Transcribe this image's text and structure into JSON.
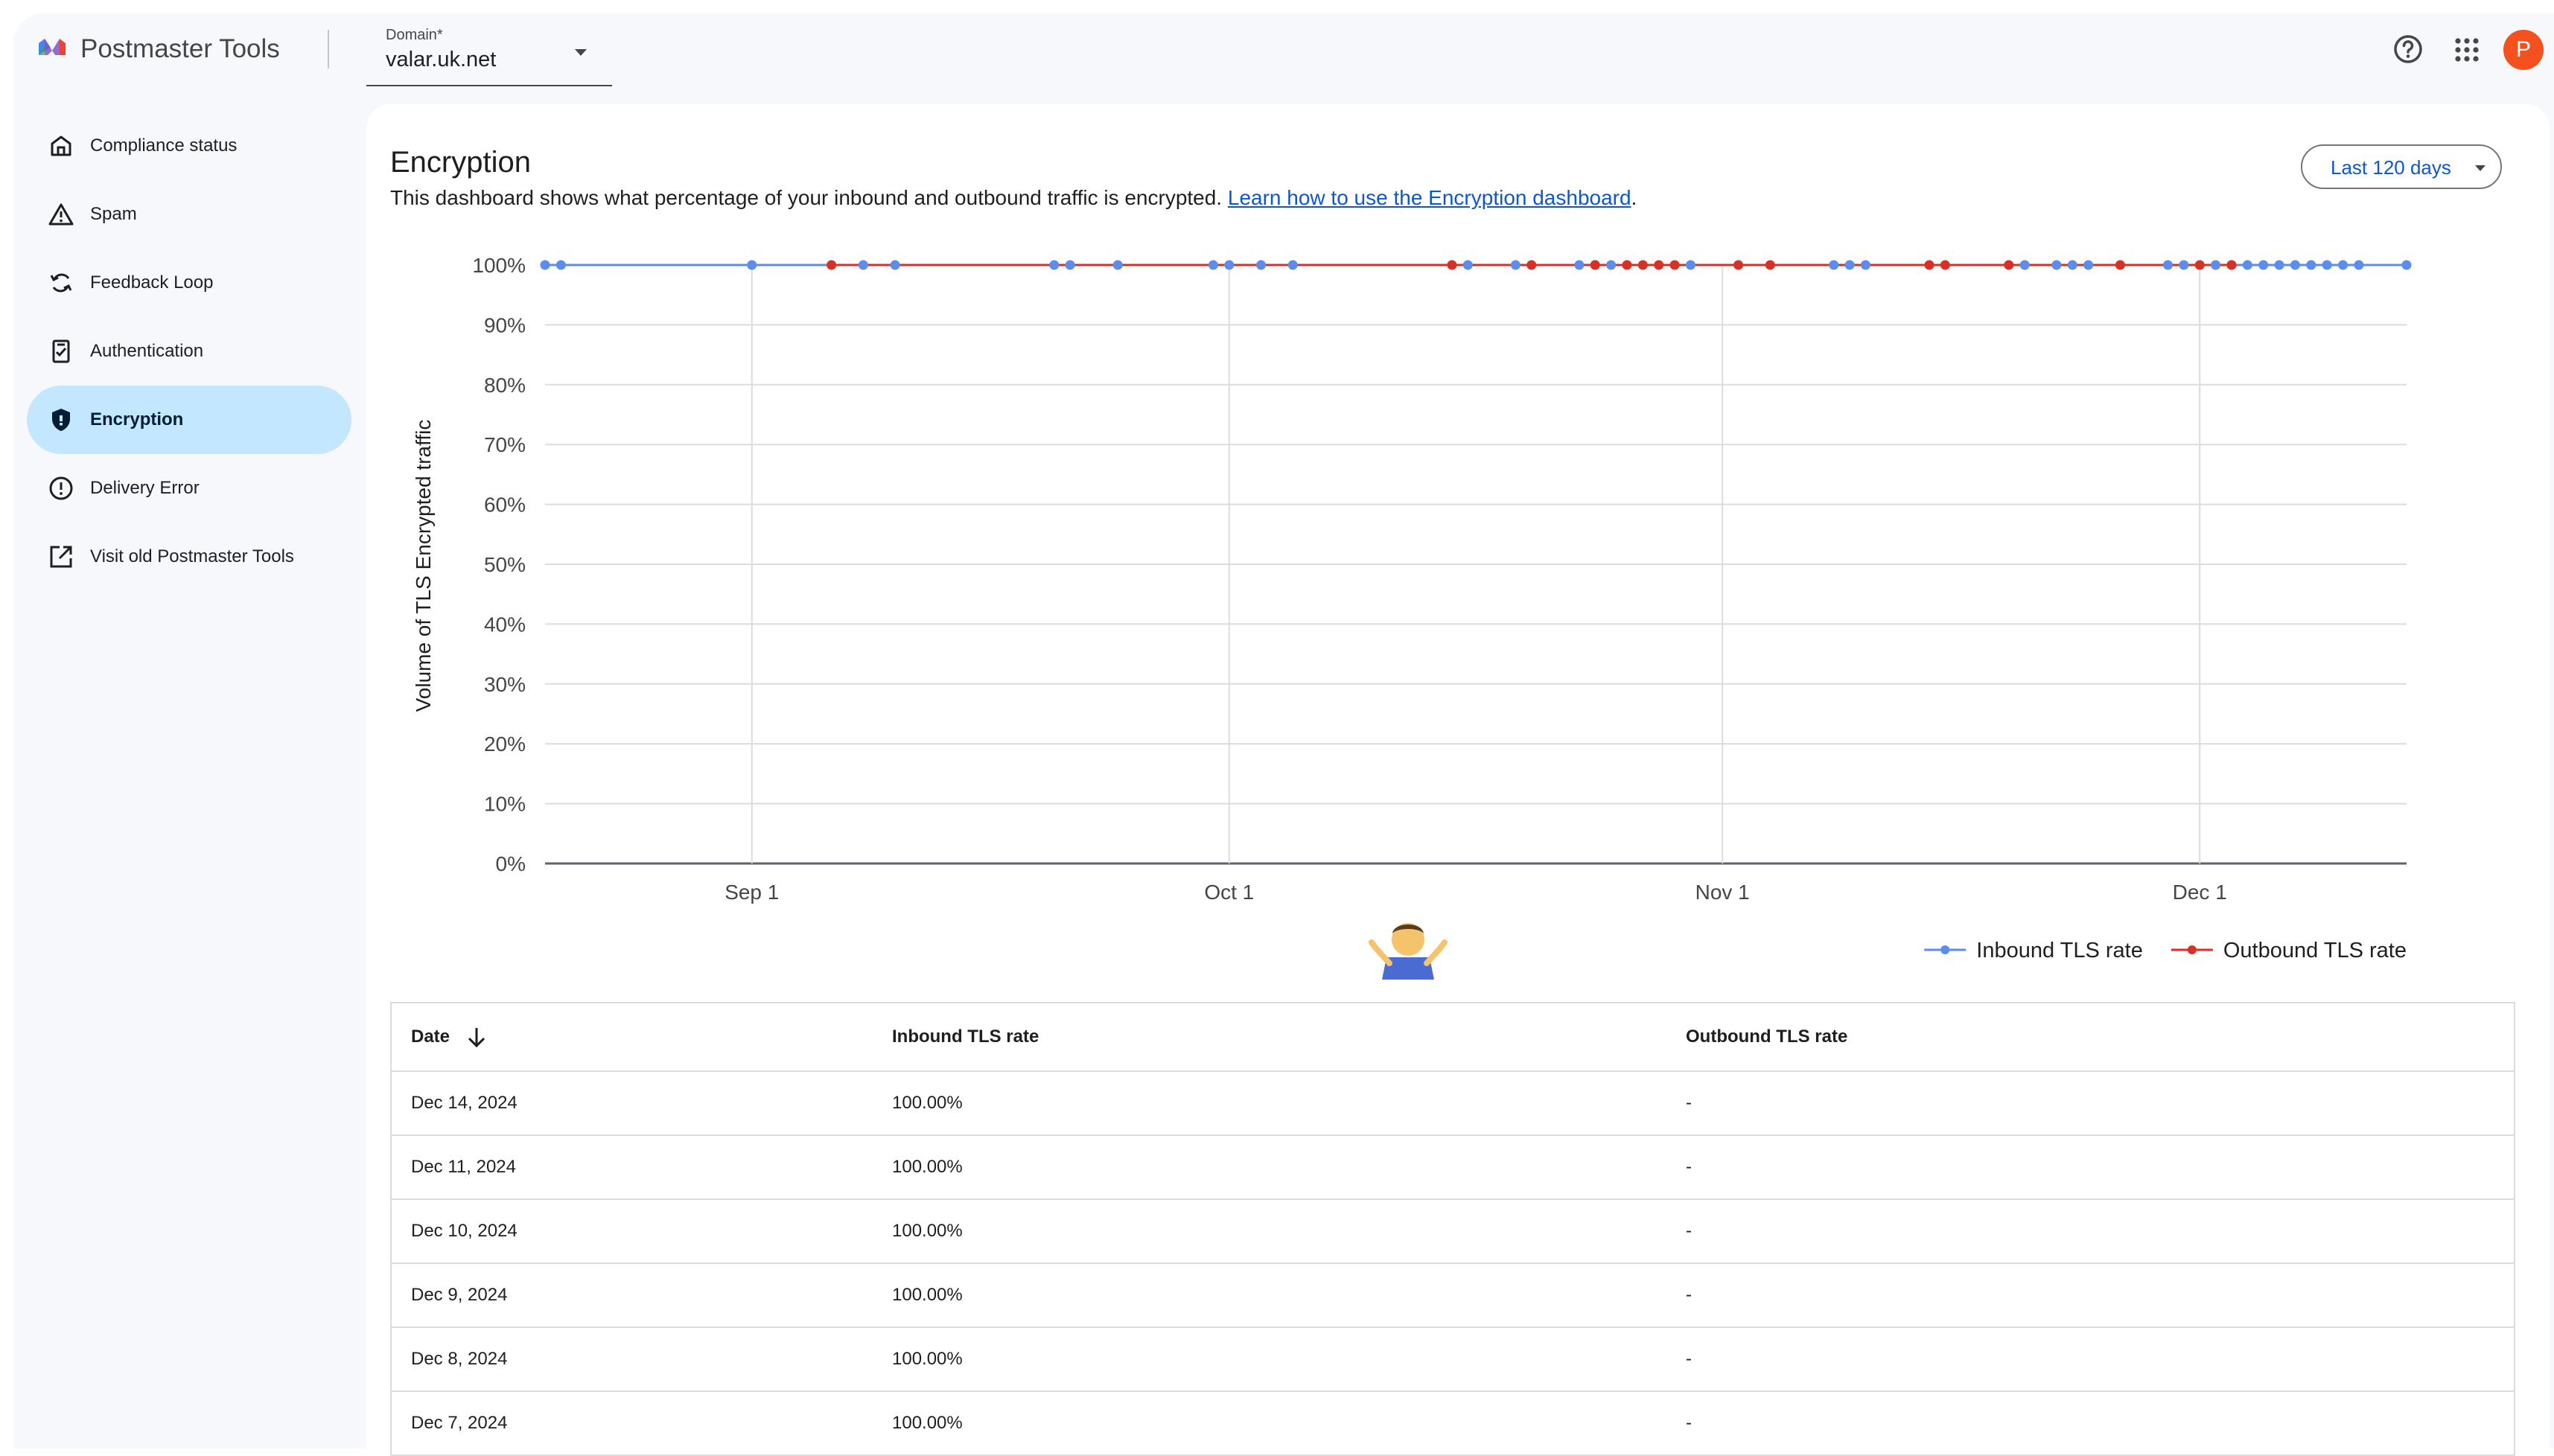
{
  "app": {
    "title": "Postmaster Tools"
  },
  "domain": {
    "label": "Domain*",
    "value": "valar.uk.net"
  },
  "header": {
    "avatar_letter": "P",
    "help_icon": "help-circle-icon",
    "apps_icon": "apps-grid-icon"
  },
  "sidebar": {
    "items": [
      {
        "label": "Compliance status",
        "icon": "home-icon",
        "active": false
      },
      {
        "label": "Spam",
        "icon": "warning-icon",
        "active": false
      },
      {
        "label": "Feedback Loop",
        "icon": "refresh-icon",
        "active": false
      },
      {
        "label": "Authentication",
        "icon": "checklist-icon",
        "active": false
      },
      {
        "label": "Encryption",
        "icon": "shield-icon",
        "active": true
      },
      {
        "label": "Delivery Error",
        "icon": "error-icon",
        "active": false
      },
      {
        "label": "Visit old Postmaster Tools",
        "icon": "open-in-new-icon",
        "active": false
      }
    ]
  },
  "page": {
    "title": "Encryption",
    "description": "This dashboard shows what percentage of your inbound and outbound traffic is encrypted.",
    "link": "Learn how to use the Encryption dashboard",
    "period": ".",
    "range": "Last 120 days"
  },
  "chart_data": {
    "type": "line",
    "ylabel": "Volume of TLS Encrypted traffic",
    "xlabel": "",
    "ylim": [
      0,
      100
    ],
    "y_ticks": [
      "0%",
      "10%",
      "20%",
      "30%",
      "40%",
      "50%",
      "60%",
      "70%",
      "80%",
      "90%",
      "100%"
    ],
    "x_range": [
      "2024-08-19",
      "2024-12-14"
    ],
    "x_ticks": [
      {
        "date": "2024-09-01",
        "label": "Sep 1"
      },
      {
        "date": "2024-10-01",
        "label": "Oct 1"
      },
      {
        "date": "2024-11-01",
        "label": "Nov 1"
      },
      {
        "date": "2024-12-01",
        "label": "Dec 1"
      }
    ],
    "grid": true,
    "legend_position": "bottom-right",
    "series": [
      {
        "name": "Inbound TLS rate",
        "color": "#5b8def",
        "points": [
          [
            "2024-08-19",
            100
          ],
          [
            "2024-08-20",
            100
          ],
          [
            "2024-09-01",
            100
          ],
          [
            "2024-09-08",
            100
          ],
          [
            "2024-09-10",
            100
          ],
          [
            "2024-09-20",
            100
          ],
          [
            "2024-09-21",
            100
          ],
          [
            "2024-09-24",
            100
          ],
          [
            "2024-09-30",
            100
          ],
          [
            "2024-10-01",
            100
          ],
          [
            "2024-10-03",
            100
          ],
          [
            "2024-10-05",
            100
          ],
          [
            "2024-10-16",
            100
          ],
          [
            "2024-10-19",
            100
          ],
          [
            "2024-10-23",
            100
          ],
          [
            "2024-10-24",
            100
          ],
          [
            "2024-10-25",
            100
          ],
          [
            "2024-10-30",
            100
          ],
          [
            "2024-11-08",
            100
          ],
          [
            "2024-11-09",
            100
          ],
          [
            "2024-11-10",
            100
          ],
          [
            "2024-11-20",
            100
          ],
          [
            "2024-11-22",
            100
          ],
          [
            "2024-11-23",
            100
          ],
          [
            "2024-11-24",
            100
          ],
          [
            "2024-11-29",
            100
          ],
          [
            "2024-11-30",
            100
          ],
          [
            "2024-12-02",
            100
          ],
          [
            "2024-12-03",
            100
          ],
          [
            "2024-12-04",
            100
          ],
          [
            "2024-12-05",
            100
          ],
          [
            "2024-12-06",
            100
          ],
          [
            "2024-12-07",
            100
          ],
          [
            "2024-12-08",
            100
          ],
          [
            "2024-12-09",
            100
          ],
          [
            "2024-12-10",
            100
          ],
          [
            "2024-12-11",
            100
          ],
          [
            "2024-12-14",
            100
          ]
        ]
      },
      {
        "name": "Outbound TLS rate",
        "color": "#d93025",
        "points": [
          [
            "2024-09-06",
            100
          ],
          [
            "2024-10-15",
            100
          ],
          [
            "2024-10-20",
            100
          ],
          [
            "2024-10-24",
            100
          ],
          [
            "2024-10-26",
            100
          ],
          [
            "2024-10-27",
            100
          ],
          [
            "2024-10-28",
            100
          ],
          [
            "2024-10-29",
            100
          ],
          [
            "2024-11-02",
            100
          ],
          [
            "2024-11-04",
            100
          ],
          [
            "2024-11-14",
            100
          ],
          [
            "2024-11-15",
            100
          ],
          [
            "2024-11-19",
            100
          ],
          [
            "2024-11-26",
            100
          ],
          [
            "2024-12-01",
            100
          ],
          [
            "2024-12-03",
            100
          ]
        ]
      }
    ]
  },
  "table": {
    "headers": [
      "Date",
      "Inbound TLS rate",
      "Outbound TLS rate"
    ],
    "rows": [
      [
        "Dec 14, 2024",
        "100.00%",
        "-"
      ],
      [
        "Dec 11, 2024",
        "100.00%",
        "-"
      ],
      [
        "Dec 10, 2024",
        "100.00%",
        "-"
      ],
      [
        "Dec 9, 2024",
        "100.00%",
        "-"
      ],
      [
        "Dec 8, 2024",
        "100.00%",
        "-"
      ],
      [
        "Dec 7, 2024",
        "100.00%",
        "-"
      ]
    ]
  }
}
